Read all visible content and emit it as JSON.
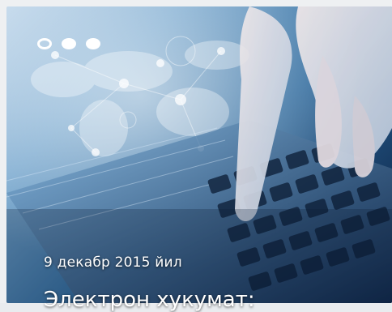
{
  "slider": {
    "dots": [
      {
        "icon": "dot-active"
      },
      {
        "icon": "dot"
      },
      {
        "icon": "dot"
      }
    ],
    "active_index": 0,
    "image": "hand-typing-on-keyboard-with-world-map-overlay"
  },
  "caption": {
    "date": "9 декабр 2015 йил",
    "title": "Электрон хукумат:"
  },
  "colors": {
    "dot": "#ffffff",
    "text": "#ffffff",
    "backdrop_light": "#bfd6ea",
    "backdrop_dark": "#0f2747"
  }
}
